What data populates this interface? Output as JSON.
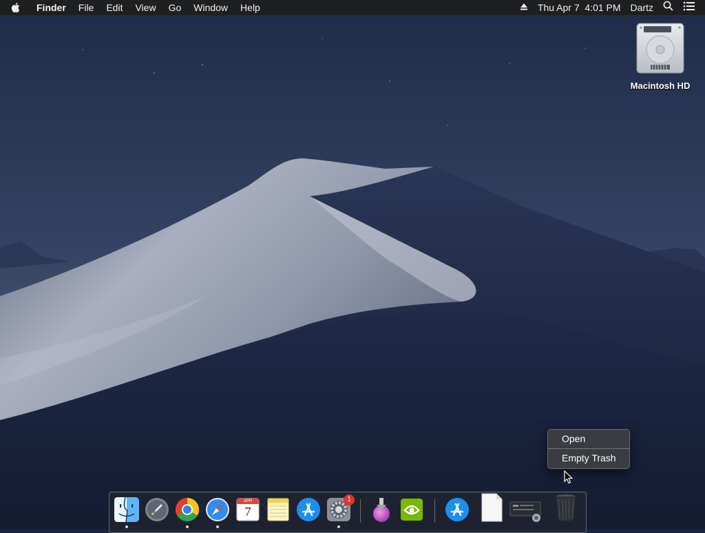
{
  "menubar": {
    "app_name": "Finder",
    "menus": [
      "File",
      "Edit",
      "View",
      "Go",
      "Window",
      "Help"
    ],
    "right": {
      "eject_icon": "eject-icon",
      "datetime": "Thu Apr 7  4:01 PM",
      "user": "Dartz",
      "search_icon": "spotlight-search-icon",
      "notification_icon": "notification-center-icon"
    }
  },
  "desktop": {
    "icons": [
      {
        "label": "Macintosh HD",
        "icon": "hard-drive-icon"
      }
    ]
  },
  "context_menu": {
    "items": [
      "Open",
      "Empty Trash"
    ]
  },
  "dock": {
    "items": [
      {
        "name": "Finder",
        "icon": "finder-icon",
        "running": true
      },
      {
        "name": "Launchpad",
        "icon": "launchpad-icon",
        "running": false
      },
      {
        "name": "Google Chrome",
        "icon": "chrome-icon",
        "running": true
      },
      {
        "name": "Safari",
        "icon": "safari-icon",
        "running": true
      },
      {
        "name": "Calendar",
        "icon": "calendar-icon",
        "running": false,
        "month": "APR",
        "day": "7"
      },
      {
        "name": "Notes",
        "icon": "notes-icon",
        "running": false
      },
      {
        "name": "App Store",
        "icon": "app-store-icon",
        "running": false
      },
      {
        "name": "System Preferences",
        "icon": "system-preferences-icon",
        "running": true,
        "badge": "1"
      },
      {
        "name": "Installer",
        "icon": "installer-icon",
        "running": false
      },
      {
        "name": "NVIDIA",
        "icon": "nvidia-icon",
        "running": false
      },
      {
        "name": "App Store Folder",
        "icon": "app-store-icon",
        "running": false
      },
      {
        "name": "Document",
        "icon": "document-icon",
        "running": false
      },
      {
        "name": "Screenshot",
        "icon": "screenshot-icon",
        "running": false
      },
      {
        "name": "Trash",
        "icon": "trash-icon",
        "running": false
      }
    ]
  },
  "colors": {
    "menubar_bg": "#1e1f21",
    "sky_top": "#22304f",
    "sky_bottom": "#42526f",
    "dune_light": "#a9b0c0",
    "dune_dark": "#1d2743",
    "badge_red": "#e0342c"
  }
}
